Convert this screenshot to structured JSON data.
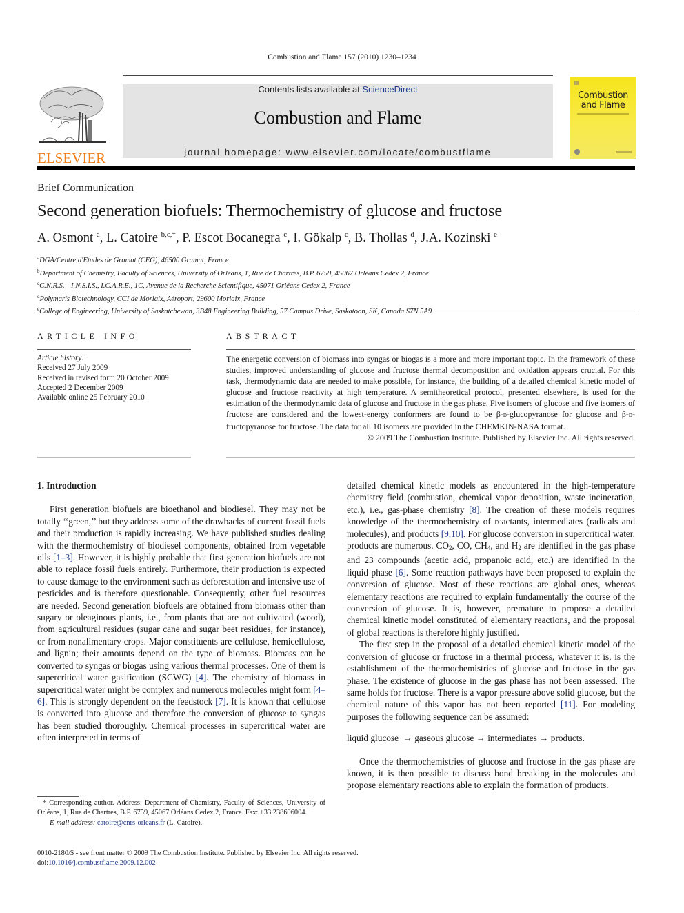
{
  "running_head": "Combustion and Flame 157 (2010) 1230–1234",
  "banner": {
    "contents_prefix": "Contents lists available at ",
    "contents_link": "ScienceDirect",
    "journal_title": "Combustion and Flame",
    "homepage": "journal homepage: www.elsevier.com/locate/combustflame"
  },
  "publisher_logo": {
    "text": "ELSEVIER",
    "color": "#f07f1a",
    "icon": "elsevier-tree-icon"
  },
  "cover": {
    "title_line1": "Combustion",
    "title_line2": "and Flame",
    "color": "#f6e51c"
  },
  "article": {
    "type": "Brief Communication",
    "title": "Second generation biofuels: Thermochemistry of glucose and fructose",
    "authors": [
      {
        "name": "A. Osmont",
        "sup": "a",
        "sep": ", "
      },
      {
        "name": "L. Catoire",
        "sup": "b,c,*",
        "sep": ", "
      },
      {
        "name": "P. Escot Bocanegra",
        "sup": "c",
        "sep": ", "
      },
      {
        "name": "I. Gökalp",
        "sup": "c",
        "sep": ", "
      },
      {
        "name": "B. Thollas",
        "sup": "d",
        "sep": ", "
      },
      {
        "name": "J.A. Kozinski",
        "sup": "e",
        "sep": ""
      }
    ],
    "affiliations": [
      {
        "sup": "a",
        "text": "DGA/Centre d'Etudes de Gramat (CEG), 46500 Gramat, France"
      },
      {
        "sup": "b",
        "text": "Department of Chemistry, Faculty of Sciences, University of Orléans, 1, Rue de Chartres, B.P. 6759, 45067 Orléans Cedex 2, France"
      },
      {
        "sup": "c",
        "text": "C.N.R.S.—I.N.S.I.S., I.C.A.R.E., 1C, Avenue de la Recherche Scientifique, 45071 Orléans Cedex 2, France"
      },
      {
        "sup": "d",
        "text": "Polymaris Biotechnology, CCI de Morlaix, Aéroport, 29600 Morlaix, France"
      },
      {
        "sup": "e",
        "text": "College of Engineering, University of Saskatchewan, 3B48 Engineering Building, 57 Campus Drive, Saskatoon, SK, Canada S7N 5A9"
      }
    ]
  },
  "article_info": {
    "heading": "ARTICLE INFO",
    "history_label": "Article history:",
    "history": [
      "Received 27 July 2009",
      "Received in revised form 20 October 2009",
      "Accepted 2 December 2009",
      "Available online 25 February 2010"
    ]
  },
  "abstract": {
    "heading": "ABSTRACT",
    "text_part1": "The energetic conversion of biomass into syngas or biogas is a more and more important topic. In the framework of these studies, improved understanding of glucose and fructose thermal decomposition and oxidation appears crucial. For this task, thermodynamic data are needed to make possible, for instance, the building of a detailed chemical kinetic model of glucose and fructose reactivity at high temperature. A semitheoretical protocol, presented elsewhere, is used for the estimation of the thermodynamic data of glucose and fructose in the gas phase. Five isomers of glucose and five isomers of fructose are considered and the lowest-energy conformers are found to be β-",
    "sc1": "d",
    "text_part2": "-glucopyranose for glucose and β-",
    "sc2": "d",
    "text_part3": "-fructopyranose for fructose. The data for all 10 isomers are provided in the CHEMKIN-NASA format.",
    "copyright": "© 2009 The Combustion Institute. Published by Elsevier Inc. All rights reserved."
  },
  "intro": {
    "heading": "1. Introduction",
    "left_p1": [
      {
        "t": "First generation biofuels are bioethanol and biodiesel. They may not be totally ‘‘green,’’ but they address some of the drawbacks of current fossil fuels and their production is rapidly increasing. We have published studies dealing with the thermochemistry of biodiesel components, obtained from vegetable oils "
      },
      {
        "ref": "[1–3]"
      },
      {
        "t": ". However, it is highly probable that first generation biofuels are not able to replace fossil fuels entirely. Furthermore, their production is expected to cause damage to the environment such as deforestation and intensive use of pesticides and is therefore questionable. Consequently, other fuel resources are needed. Second generation biofuels are obtained from biomass other than sugary or oleaginous plants, i.e., from plants that are not cultivated (wood), from agricultural residues (sugar cane and sugar beet residues, for instance), or from nonalimentary crops. Major constituents are cellulose, hemicellulose, and lignin; their amounts depend on the type of biomass. Biomass can be converted to syngas or biogas using various thermal processes. One of them is supercritical water gasification (SCWG) "
      },
      {
        "ref": "[4]"
      },
      {
        "t": ". The chemistry of biomass in supercritical water might be complex and numerous molecules might form "
      },
      {
        "ref": "[4–6]"
      },
      {
        "t": ". This is strongly dependent on the feedstock "
      },
      {
        "ref": "[7]"
      },
      {
        "t": ". It is known that cellulose is converted into glucose and therefore the conversion of glucose to syngas has been studied thoroughly. Chemical processes in supercritical water are often interpreted in terms of"
      }
    ],
    "right_p1": [
      {
        "t": "detailed chemical kinetic models as encountered in the high-temperature chemistry field (combustion, chemical vapor deposition, waste incineration, etc.), i.e., gas-phase chemistry "
      },
      {
        "ref": "[8]"
      },
      {
        "t": ". The creation of these models requires knowledge of the thermochemistry of reactants, intermediates (radicals and molecules), and products "
      },
      {
        "ref": "[9,10]"
      },
      {
        "t": ". For glucose conversion in supercritical water, products are numerous. CO"
      },
      {
        "sub": "2"
      },
      {
        "t": ", CO, CH"
      },
      {
        "sub": "4"
      },
      {
        "t": ", and H"
      },
      {
        "sub": "2"
      },
      {
        "t": " are identified in the gas phase and 23 compounds (acetic acid, propanoic acid, etc.) are identified in the liquid phase "
      },
      {
        "ref": "[6]"
      },
      {
        "t": ". Some reaction pathways have been proposed to explain the conversion of glucose. Most of these reactions are global ones, whereas elementary reactions are required to explain fundamentally the course of the conversion of glucose. It is, however, premature to propose a detailed chemical kinetic model constituted of elementary reactions, and the proposal of global reactions is therefore highly justified."
      }
    ],
    "right_p2": [
      {
        "t": "The first step in the proposal of a detailed chemical kinetic model of the conversion of glucose or fructose in a thermal process, whatever it is, is the establishment of the thermochemistries of glucose and fructose in the gas phase. The existence of glucose in the gas phase has not been assessed. The same holds for fructose. There is a vapor pressure above solid glucose, but the chemical nature of this vapor has not been reported "
      },
      {
        "ref": "[11]"
      },
      {
        "t": ". For modeling purposes the following sequence can be assumed:"
      }
    ],
    "equation": "liquid glucose  → gaseous glucose → intermediates → products.",
    "right_p3": "Once the thermochemistries of glucose and fructose in the gas phase are known, it is then possible to discuss bond breaking in the molecules and propose elementary reactions able to explain the formation of products."
  },
  "footnote": {
    "corresponding": "* Corresponding author. Address: Department of Chemistry, Faculty of Sciences, University of Orléans, 1, Rue de Chartres, B.P. 6759, 45067 Orléans Cedex 2, France. Fax: +33 238696004.",
    "email_label": "E-mail address:",
    "email": "catoire@cnrs-orleans.fr",
    "email_suffix": " (L. Catoire)."
  },
  "bottom": {
    "issn_line": "0010-2180/$ - see front matter © 2009 The Combustion Institute. Published by Elsevier Inc. All rights reserved.",
    "doi_prefix": "doi:",
    "doi": "10.1016/j.combustflame.2009.12.002"
  },
  "colors": {
    "link": "#1f3b8c",
    "banner_bg": "#e4e4e4",
    "elsevier_orange": "#f07f1a"
  }
}
